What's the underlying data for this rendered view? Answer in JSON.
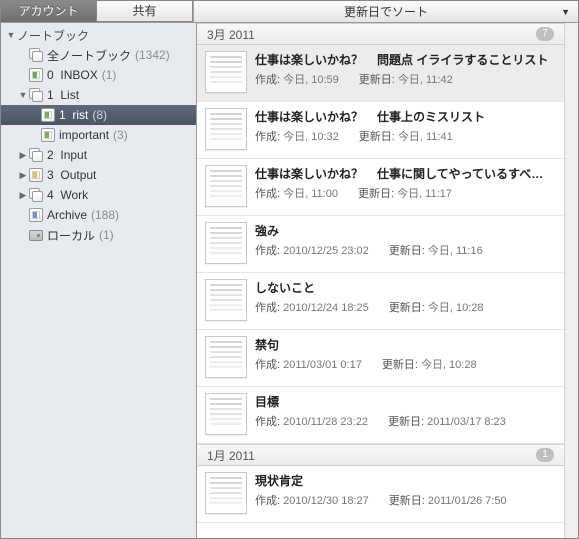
{
  "tabs": {
    "account": "アカウント",
    "share": "共有"
  },
  "sort": {
    "label": "更新日でソート"
  },
  "sidebar": {
    "header": "ノートブック",
    "all": {
      "label": "全ノートブック",
      "count": "(1342)"
    },
    "inbox": {
      "prefix": "0",
      "label": "INBOX",
      "count": "(1)"
    },
    "list": {
      "prefix": "1",
      "label": "List"
    },
    "rist": {
      "prefix": "1",
      "label": "rist",
      "count": "(8)"
    },
    "important": {
      "label": "important",
      "count": "(3)"
    },
    "input": {
      "prefix": "2",
      "label": "Input"
    },
    "output": {
      "prefix": "3",
      "label": "Output"
    },
    "work": {
      "prefix": "4",
      "label": "Work"
    },
    "archive": {
      "label": "Archive",
      "count": "(188)"
    },
    "local": {
      "label": "ローカル",
      "count": "(1)"
    }
  },
  "groups": [
    {
      "label": "3月 2011",
      "badge": "7"
    },
    {
      "label": "1月 2011",
      "badge": "1"
    }
  ],
  "notes": [
    {
      "t1": "仕事は楽しいかね？",
      "t2": "問題点 イライラすることリスト",
      "c_label": "作成:",
      "c_val": "今日, 10:59",
      "u_label": "更新日:",
      "u_val": "今日, 11:42",
      "sel": true
    },
    {
      "t1": "仕事は楽しいかね？",
      "t2": "仕事上のミスリスト",
      "c_label": "作成:",
      "c_val": "今日, 10:32",
      "u_label": "更新日:",
      "u_val": "今日, 11:41"
    },
    {
      "t1": "仕事は楽しいかね？",
      "t2": "仕事に関してやっているすべ…",
      "c_label": "作成:",
      "c_val": "今日, 11:00",
      "u_label": "更新日:",
      "u_val": "今日, 11:17"
    },
    {
      "t1": "強み",
      "t2": "",
      "c_label": "作成:",
      "c_val": "2010/12/25 23:02",
      "u_label": "更新日:",
      "u_val": "今日, 11:16"
    },
    {
      "t1": "しないこと",
      "t2": "",
      "c_label": "作成:",
      "c_val": "2010/12/24 18:25",
      "u_label": "更新日:",
      "u_val": "今日, 10:28"
    },
    {
      "t1": "禁句",
      "t2": "",
      "c_label": "作成:",
      "c_val": "2011/03/01 0:17",
      "u_label": "更新日:",
      "u_val": "今日, 10:28"
    },
    {
      "t1": "目標",
      "t2": "",
      "c_label": "作成:",
      "c_val": "2010/11/28 23:22",
      "u_label": "更新日:",
      "u_val": "2011/03/17 8:23"
    }
  ],
  "notes2": [
    {
      "t1": "現状肯定",
      "t2": "",
      "c_label": "作成:",
      "c_val": "2010/12/30 18:27",
      "u_label": "更新日:",
      "u_val": "2011/01/26 7:50"
    }
  ]
}
